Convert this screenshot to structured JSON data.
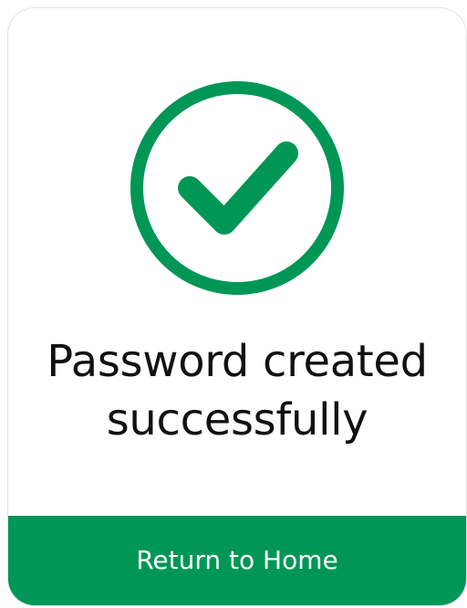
{
  "colors": {
    "accent": "#009656",
    "text": "#111111",
    "button_text": "#ffffff"
  },
  "success_icon": {
    "name": "check-circle-icon"
  },
  "message": {
    "line1": "Password created",
    "line2": "successfully"
  },
  "action": {
    "label": "Return to Home"
  }
}
